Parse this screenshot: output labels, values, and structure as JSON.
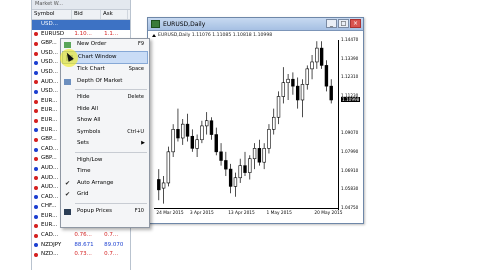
{
  "market_watch": {
    "title": "Market W...",
    "columns": {
      "symbol": "Symbol",
      "bid": "Bid",
      "ask": "Ask"
    },
    "rows": [
      {
        "symbol": "USD...",
        "bid": "",
        "ask": "",
        "dot": "#3d72c4",
        "dir": "up"
      },
      {
        "symbol": "EURUSD",
        "bid": "1.10...",
        "ask": "1.1...",
        "dot": "#d42020",
        "dir": "down"
      },
      {
        "symbol": "GBP...",
        "bid": "",
        "ask": "",
        "dot": "#d42020",
        "dir": "down"
      },
      {
        "symbol": "USD...",
        "bid": "",
        "ask": "",
        "dot": "#d42020",
        "dir": "down"
      },
      {
        "symbol": "USD...",
        "bid": "",
        "ask": "",
        "dot": "#1b3fd0",
        "dir": "up"
      },
      {
        "symbol": "USD...",
        "bid": "",
        "ask": "",
        "dot": "#1b3fd0",
        "dir": "up"
      },
      {
        "symbol": "AUD...",
        "bid": "",
        "ask": "",
        "dot": "#d42020",
        "dir": "down"
      },
      {
        "symbol": "USD...",
        "bid": "",
        "ask": "",
        "dot": "#1b3fd0",
        "dir": "up"
      },
      {
        "symbol": "EUR...",
        "bid": "",
        "ask": "",
        "dot": "#d42020",
        "dir": "down"
      },
      {
        "symbol": "EUR...",
        "bid": "",
        "ask": "",
        "dot": "#d42020",
        "dir": "down"
      },
      {
        "symbol": "EUR...",
        "bid": "",
        "ask": "",
        "dot": "#d42020",
        "dir": "down"
      },
      {
        "symbol": "EUR...",
        "bid": "",
        "ask": "",
        "dot": "#1b3fd0",
        "dir": "up"
      },
      {
        "symbol": "GBP...",
        "bid": "",
        "ask": "",
        "dot": "#d42020",
        "dir": "down"
      },
      {
        "symbol": "CAD...",
        "bid": "",
        "ask": "",
        "dot": "#1b3fd0",
        "dir": "up"
      },
      {
        "symbol": "GBP...",
        "bid": "",
        "ask": "",
        "dot": "#d42020",
        "dir": "down"
      },
      {
        "symbol": "AUD...",
        "bid": "",
        "ask": "",
        "dot": "#1b3fd0",
        "dir": "up"
      },
      {
        "symbol": "AUD...",
        "bid": "",
        "ask": "",
        "dot": "#d42020",
        "dir": "down"
      },
      {
        "symbol": "AUD...",
        "bid": "",
        "ask": "",
        "dot": "#d42020",
        "dir": "down"
      },
      {
        "symbol": "CAD...",
        "bid": "",
        "ask": "",
        "dot": "#1b3fd0",
        "dir": "up"
      },
      {
        "symbol": "CHF...",
        "bid": "",
        "ask": "",
        "dot": "#1b3fd0",
        "dir": "up"
      },
      {
        "symbol": "EUR...",
        "bid": "",
        "ask": "",
        "dot": "#1b3fd0",
        "dir": "up"
      },
      {
        "symbol": "EUR...",
        "bid": "1.55...",
        "ask": "1.5...",
        "dot": "#d42020",
        "dir": "down"
      },
      {
        "symbol": "CAD...",
        "bid": "0.76...",
        "ask": "0.7...",
        "dot": "#d42020",
        "dir": "down"
      },
      {
        "symbol": "NZDJPY",
        "bid": "88.671",
        "ask": "89.070",
        "dot": "#1b3fd0",
        "dir": "up"
      },
      {
        "symbol": "NZD...",
        "bid": "0.73...",
        "ask": "0.7...",
        "dot": "#d42020",
        "dir": "down"
      }
    ]
  },
  "context_menu": {
    "items": [
      {
        "label": "New Order",
        "shortcut": "F9",
        "icon": "new-order-icon"
      },
      {
        "label": "Chart Window",
        "shortcut": "",
        "icon": "chart-window-icon",
        "highlighted": true
      },
      {
        "label": "Tick Chart",
        "shortcut": "Space",
        "icon": ""
      },
      {
        "label": "Depth Of Market",
        "shortcut": "",
        "icon": "depth-of-market-icon"
      },
      {
        "separator": true
      },
      {
        "label": "Hide",
        "shortcut": "Delete",
        "icon": ""
      },
      {
        "label": "Hide All",
        "shortcut": "",
        "icon": ""
      },
      {
        "label": "Show All",
        "shortcut": "",
        "icon": ""
      },
      {
        "label": "Symbols",
        "shortcut": "Ctrl+U",
        "icon": ""
      },
      {
        "label": "Sets",
        "shortcut": "",
        "icon": "",
        "submenu": true
      },
      {
        "separator": true
      },
      {
        "label": "High/Low",
        "shortcut": "",
        "icon": ""
      },
      {
        "label": "Time",
        "shortcut": "",
        "icon": ""
      },
      {
        "label": "Auto Arrange",
        "shortcut": "",
        "icon": "",
        "checked": true
      },
      {
        "label": "Grid",
        "shortcut": "",
        "icon": "",
        "checked": true
      },
      {
        "separator": true
      },
      {
        "label": "Popup Prices",
        "shortcut": "F10",
        "icon": "popup-prices-icon"
      }
    ]
  },
  "chart_window": {
    "title": "EURUSD,Daily",
    "info": "EURUSD,Daily  1.11076 1.11085 1.10818 1.10998",
    "buttons": {
      "minimize": "_",
      "maximize": "□",
      "close": "×"
    }
  },
  "chart_data": {
    "type": "candlestick",
    "title": "EURUSD,Daily",
    "ohlc_label": "1.11076 1.11085 1.10818 1.10998",
    "y_ticks": [
      "1.14470",
      "1.13390",
      "1.12310",
      "1.11230",
      "1.10998",
      "1.09070",
      "1.07990",
      "1.06910",
      "1.05830",
      "1.04750"
    ],
    "current_price": "1.10998",
    "x_ticks": [
      "24 Mar 2015",
      "3 Apr 2015",
      "13 Apr 2015",
      "1 May 2015",
      "20 May 2015"
    ],
    "ylim": [
      1.0475,
      1.1447
    ],
    "candles": [
      {
        "o": 1.064,
        "h": 1.07,
        "l": 1.052,
        "c": 1.058
      },
      {
        "o": 1.059,
        "h": 1.066,
        "l": 1.05,
        "c": 1.062
      },
      {
        "o": 1.062,
        "h": 1.083,
        "l": 1.06,
        "c": 1.08
      },
      {
        "o": 1.08,
        "h": 1.096,
        "l": 1.077,
        "c": 1.093
      },
      {
        "o": 1.093,
        "h": 1.105,
        "l": 1.086,
        "c": 1.088
      },
      {
        "o": 1.088,
        "h": 1.099,
        "l": 1.084,
        "c": 1.096
      },
      {
        "o": 1.096,
        "h": 1.102,
        "l": 1.086,
        "c": 1.089
      },
      {
        "o": 1.089,
        "h": 1.093,
        "l": 1.08,
        "c": 1.082
      },
      {
        "o": 1.082,
        "h": 1.09,
        "l": 1.077,
        "c": 1.087
      },
      {
        "o": 1.087,
        "h": 1.098,
        "l": 1.085,
        "c": 1.095
      },
      {
        "o": 1.095,
        "h": 1.103,
        "l": 1.09,
        "c": 1.098
      },
      {
        "o": 1.098,
        "h": 1.1,
        "l": 1.087,
        "c": 1.09
      },
      {
        "o": 1.09,
        "h": 1.094,
        "l": 1.078,
        "c": 1.08
      },
      {
        "o": 1.08,
        "h": 1.085,
        "l": 1.072,
        "c": 1.075
      },
      {
        "o": 1.075,
        "h": 1.08,
        "l": 1.066,
        "c": 1.07
      },
      {
        "o": 1.07,
        "h": 1.073,
        "l": 1.056,
        "c": 1.06
      },
      {
        "o": 1.06,
        "h": 1.068,
        "l": 1.054,
        "c": 1.065
      },
      {
        "o": 1.065,
        "h": 1.076,
        "l": 1.062,
        "c": 1.072
      },
      {
        "o": 1.072,
        "h": 1.08,
        "l": 1.066,
        "c": 1.068
      },
      {
        "o": 1.068,
        "h": 1.078,
        "l": 1.064,
        "c": 1.076
      },
      {
        "o": 1.076,
        "h": 1.085,
        "l": 1.07,
        "c": 1.082
      },
      {
        "o": 1.082,
        "h": 1.087,
        "l": 1.072,
        "c": 1.074
      },
      {
        "o": 1.074,
        "h": 1.085,
        "l": 1.07,
        "c": 1.082
      },
      {
        "o": 1.082,
        "h": 1.096,
        "l": 1.079,
        "c": 1.093
      },
      {
        "o": 1.093,
        "h": 1.105,
        "l": 1.09,
        "c": 1.1
      },
      {
        "o": 1.1,
        "h": 1.115,
        "l": 1.096,
        "c": 1.112
      },
      {
        "o": 1.112,
        "h": 1.129,
        "l": 1.108,
        "c": 1.12
      },
      {
        "o": 1.12,
        "h": 1.125,
        "l": 1.11,
        "c": 1.122
      },
      {
        "o": 1.122,
        "h": 1.126,
        "l": 1.113,
        "c": 1.118
      },
      {
        "o": 1.118,
        "h": 1.123,
        "l": 1.105,
        "c": 1.11
      },
      {
        "o": 1.11,
        "h": 1.122,
        "l": 1.1,
        "c": 1.119
      },
      {
        "o": 1.119,
        "h": 1.13,
        "l": 1.116,
        "c": 1.128
      },
      {
        "o": 1.128,
        "h": 1.136,
        "l": 1.122,
        "c": 1.132
      },
      {
        "o": 1.132,
        "h": 1.144,
        "l": 1.128,
        "c": 1.14
      },
      {
        "o": 1.14,
        "h": 1.144,
        "l": 1.128,
        "c": 1.13
      },
      {
        "o": 1.13,
        "h": 1.133,
        "l": 1.115,
        "c": 1.118
      },
      {
        "o": 1.118,
        "h": 1.122,
        "l": 1.108,
        "c": 1.11
      }
    ]
  }
}
